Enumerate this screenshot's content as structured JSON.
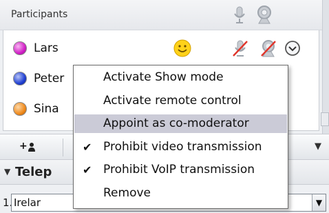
{
  "participants_panel": {
    "title": "Participants",
    "header_icons": [
      "microphone-icon",
      "webcam-icon"
    ],
    "participants": [
      {
        "name": "Lars",
        "status_color": "#d21fc7",
        "icons": [
          "smiley-icon",
          "microphone-muted-icon",
          "webcam-off-icon",
          "options-dropdown-icon"
        ]
      },
      {
        "name": "Peter",
        "status_color": "#1f3fd2"
      },
      {
        "name": "Sina",
        "status_color": "#f08a1c"
      }
    ]
  },
  "toolbar": {
    "add_label": "+"
  },
  "telephony": {
    "title": "Telep",
    "dial_index": "1.",
    "dial_value": "Irelar"
  },
  "context_menu": {
    "items": [
      {
        "label": "Activate Show mode",
        "checked": false
      },
      {
        "label": "Activate remote control",
        "checked": false
      },
      {
        "label": "Appoint as co-moderator",
        "checked": false,
        "highlighted": true
      },
      {
        "label": "Prohibit video transmission",
        "checked": true,
        "check": "✔"
      },
      {
        "label": "Prohibit VoIP transmission",
        "checked": true,
        "check": "✔"
      },
      {
        "label": "Remove",
        "checked": false
      }
    ]
  }
}
